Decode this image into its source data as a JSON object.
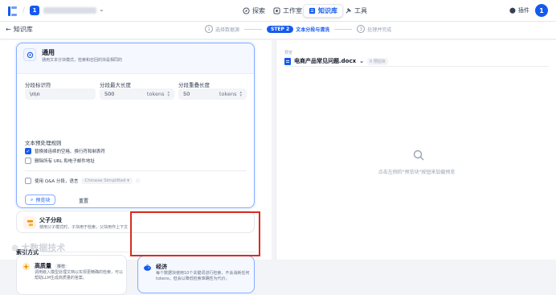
{
  "nav": {
    "workspace_initial": "1",
    "items": [
      {
        "label": "探索",
        "icon": "compass-icon"
      },
      {
        "label": "工作室",
        "icon": "studio-icon"
      },
      {
        "label": "知识库",
        "icon": "knowledge-icon",
        "active": true
      },
      {
        "label": "工具",
        "icon": "tool-icon"
      }
    ],
    "plugins_label": "插件",
    "avatar_initial": "1"
  },
  "subnav": {
    "back_label": "知识库",
    "steps": [
      {
        "num": "1",
        "label": "选择数据源"
      },
      {
        "num": "STEP 2",
        "label": "文本分段与清洗",
        "active": true
      },
      {
        "num": "3",
        "label": "处理并完成"
      }
    ]
  },
  "general": {
    "title": "通用",
    "desc": "通用文本分块模式，检索和召回的块是相同的",
    "separator_label": "分段标识符",
    "separator_value": "\\n\\n",
    "max_len_label": "分段最大长度",
    "max_len_value": "500",
    "overlap_label": "分段重叠长度",
    "overlap_value": "50",
    "unit": "tokens",
    "rules_label": "文本预处理规则",
    "rule1": "替换掉连续的空格、换行符和制表符",
    "rule2": "删除所有 URL 和电子邮件地址",
    "qa_label": "使用 Q&A 分段，语言",
    "qa_lang": "Chinese Simplified",
    "preview_btn": "预览块",
    "reset_btn": "重置"
  },
  "parent_child": {
    "title": "父子分段",
    "desc": "使用父子模式时，子块用于检索，父块用作上下文"
  },
  "index": {
    "label": "索引方式",
    "high_quality": {
      "title": "高质量",
      "badge": "推荐",
      "desc": "调用嵌入模型处理文档以实现更精确的检索，可以帮助LLM生成高质量的答案。"
    },
    "economy": {
      "title": "经济",
      "desc": "每个数据块使用10个关键词进行检索，不会消耗任何tokens，但会以降低检索准确性为代价。"
    }
  },
  "preview": {
    "label": "预览",
    "file": "电商产品常见问题.docx",
    "count": "0 预估块",
    "empty_text": "点击左侧的\"预览块\"按钮来加载预览"
  },
  "watermark": "大数据技术"
}
